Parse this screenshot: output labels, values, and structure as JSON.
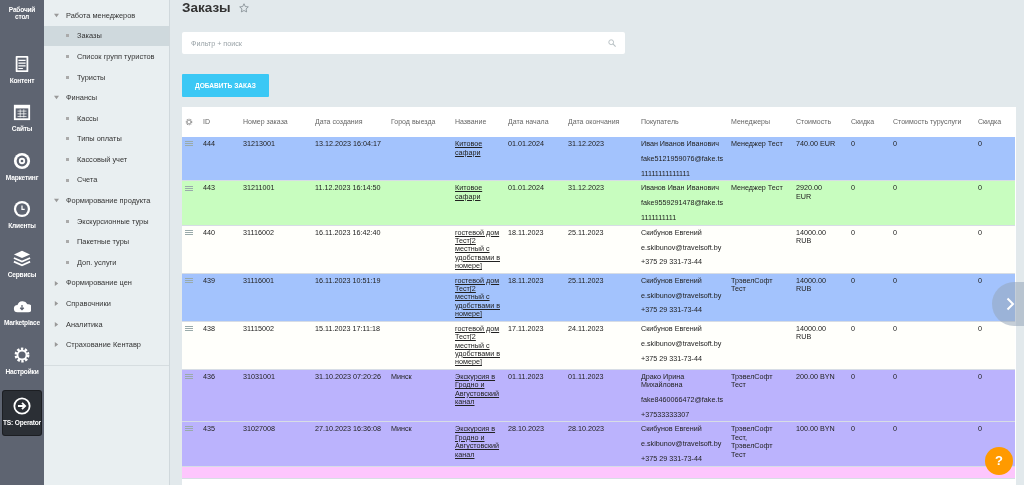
{
  "left_bar": {
    "items": [
      {
        "label": "Рабочий стол",
        "selected": false
      },
      {
        "label": "Контент",
        "selected": false
      },
      {
        "label": "Сайты",
        "selected": false
      },
      {
        "label": "Маркетинг",
        "selected": false
      },
      {
        "label": "Клиенты",
        "selected": false
      },
      {
        "label": "Сервисы",
        "selected": false
      },
      {
        "label": "Marketplace",
        "selected": false
      },
      {
        "label": "Настройки",
        "selected": false
      },
      {
        "label": "TS: Operator",
        "selected": true
      }
    ]
  },
  "menu": {
    "items": [
      {
        "label": "Работа менеджеров",
        "expanded": true,
        "children": [
          {
            "label": "Заказы",
            "selected": true
          },
          {
            "label": "Список групп туристов",
            "selected": false
          },
          {
            "label": "Туристы",
            "selected": false
          }
        ]
      },
      {
        "label": "Финансы",
        "expanded": true,
        "children": [
          {
            "label": "Кассы",
            "selected": false
          },
          {
            "label": "Типы оплаты",
            "selected": false
          },
          {
            "label": "Кассовый учет",
            "selected": false
          },
          {
            "label": "Счета",
            "selected": false
          }
        ]
      },
      {
        "label": "Формирование продукта",
        "expanded": true,
        "children": [
          {
            "label": "Экскурсионные туры",
            "selected": false
          },
          {
            "label": "Пакетные туры",
            "selected": false
          },
          {
            "label": "Доп. услуги",
            "selected": false
          }
        ]
      },
      {
        "label": "Формирование цен",
        "expanded": false
      },
      {
        "label": "Справочники",
        "expanded": false
      },
      {
        "label": "Аналитика",
        "expanded": false
      },
      {
        "label": "Страхование Кентавр",
        "expanded": false
      }
    ]
  },
  "page": {
    "title": "Заказы",
    "filter": {
      "placeholder": "Фильтр + поиск"
    },
    "add_button": "ДОБАВИТЬ ЗАКАЗ"
  },
  "table": {
    "columns": [
      "ID",
      "Номер заказа",
      "Дата создания",
      "Город выезда",
      "Название",
      "Дата начала",
      "Дата окончания",
      "Покупатель",
      "Менеджеры",
      "Стоимость",
      "Скидка",
      "Стоимость туруслуги",
      "Скидка"
    ],
    "rows": [
      {
        "color": "#a3c3fd",
        "id": "444",
        "order_no": "31213001",
        "created": "13.12.2023 16:04:17",
        "name": "Китовое сафари",
        "start": "01.01.2024",
        "end": "31.12.2023",
        "buyer": {
          "name": "Иван Иванов Иванович",
          "email": "fake5121959076@fake.ts",
          "phone": "11111111111111"
        },
        "managers": "Менеджер Тест",
        "cost": "740.00 EUR",
        "discount": "0",
        "tour_cost": "0",
        "discount_2": "0"
      },
      {
        "color": "#c8fdbf",
        "id": "443",
        "order_no": "31211001",
        "created": "11.12.2023 16:14:50",
        "name": "Китовое сафари",
        "start": "01.01.2024",
        "end": "31.12.2023",
        "buyer": {
          "name": "Иванов Иван Иванович",
          "email": "fake9559291478@fake.ts",
          "phone": "1111111111"
        },
        "managers": "Менеджер Тест",
        "cost": "2920.00 EUR",
        "discount": "0",
        "tour_cost": "0",
        "discount_2": "0"
      },
      {
        "color": "#fffffb",
        "id": "440",
        "order_no": "31116002",
        "created": "16.11.2023 16:42:40",
        "name": "гостевой дом Тест[2 местный с удобствами в номере]",
        "start": "18.11.2023",
        "end": "25.11.2023",
        "buyer": {
          "name": "Скибунов Евгений",
          "email": "e.skibunov@travelsoft.by",
          "phone": "+375 29 331-73-44"
        },
        "cost": "14000.00 RUB",
        "discount": "0",
        "tour_cost": "0",
        "discount_2": "0"
      },
      {
        "color": "#a3c3fd",
        "id": "439",
        "order_no": "31116001",
        "created": "16.11.2023 10:51:19",
        "name": "гостевой дом Тест[2 местный с удобствами в номере]",
        "start": "18.11.2023",
        "end": "25.11.2023",
        "buyer": {
          "name": "Скибунов Евгений",
          "email": "e.skibunov@travelsoft.by",
          "phone": "+375 29 331-73-44"
        },
        "managers": "ТрэвелСофт Тест",
        "cost": "14000.00 RUB",
        "discount": "0",
        "tour_cost": "0",
        "discount_2": "0"
      },
      {
        "color": "#fffffb",
        "id": "438",
        "order_no": "31115002",
        "created": "15.11.2023 17:11:18",
        "name": "гостевой дом Тест[2 местный с удобствами в номере]",
        "start": "17.11.2023",
        "end": "24.11.2023",
        "buyer": {
          "name": "Скибунов Евгений",
          "email": "e.skibunov@travelsoft.by",
          "phone": "+375 29 331-73-44"
        },
        "cost": "14000.00 RUB",
        "discount": "0",
        "tour_cost": "0",
        "discount_2": "0"
      },
      {
        "color": "#bbb3fd",
        "id": "436",
        "order_no": "31031001",
        "created": "31.10.2023 07:20:26",
        "city": "Минск",
        "name": "Экскурсия в Гродно и Августовский канал",
        "start": "01.11.2023",
        "end": "01.11.2023",
        "buyer": {
          "name": "Драко Ирина Михайловна",
          "email": "fake8460066472@fake.ts",
          "phone": "+37533333307"
        },
        "managers": "ТрэвелСофт Тест",
        "cost": "200.00 BYN",
        "discount": "0",
        "tour_cost": "0",
        "discount_2": "0"
      },
      {
        "color": "#bbb3fd",
        "id": "435",
        "order_no": "31027008",
        "created": "27.10.2023 16:36:08",
        "city": "Минск",
        "name": "Экскурсия в Гродно и Августовский канал",
        "start": "28.10.2023",
        "end": "28.10.2023",
        "buyer": {
          "name": "Скибунов Евгений",
          "email": "e.skibunov@travelsoft.by",
          "phone": "+375 29 331-73-44"
        },
        "managers": "ТрэвелСофт Тест, ТрэвелСофт Тест",
        "cost": "100.00 BYN",
        "discount": "0",
        "tour_cost": "0",
        "discount_2": "0"
      },
      {
        "color": "#fdc6fd"
      }
    ]
  },
  "help_button": "?"
}
